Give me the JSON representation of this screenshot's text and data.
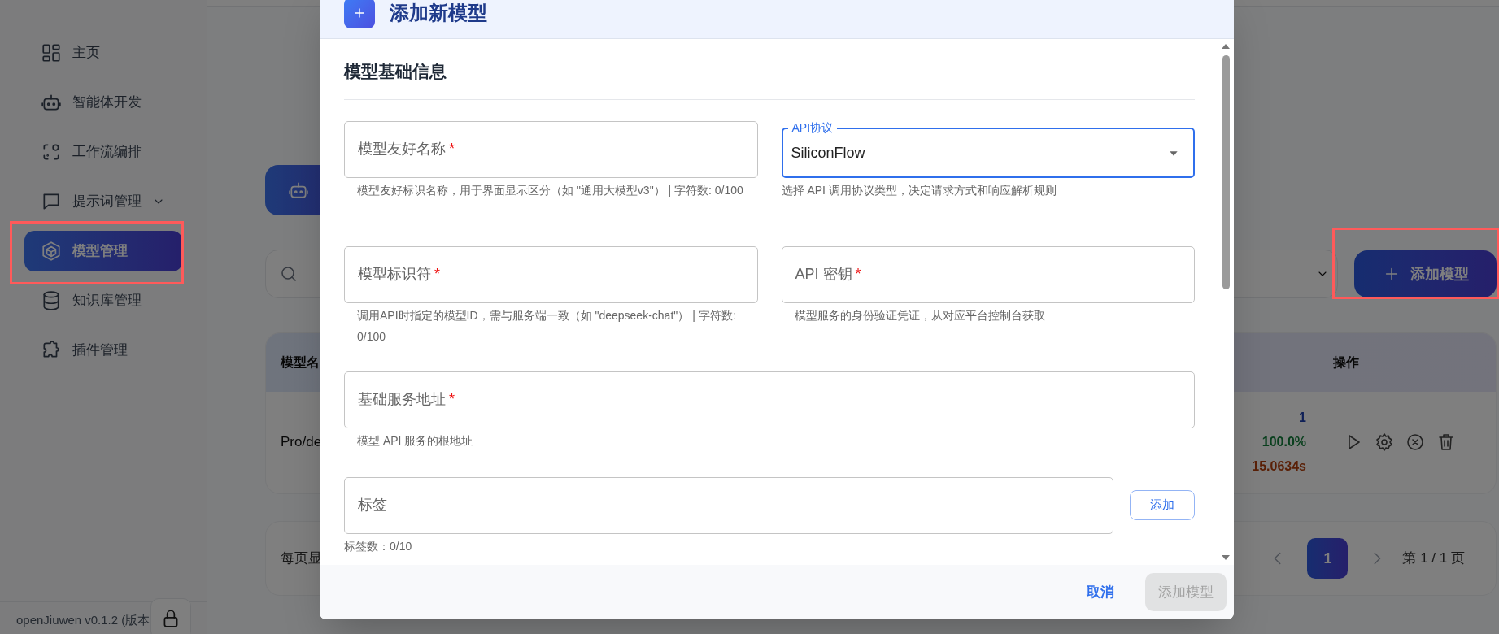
{
  "sidebar": {
    "items": [
      {
        "label": "主页",
        "kind": "link",
        "selected": false,
        "highlighted": false
      },
      {
        "label": "智能体开发",
        "kind": "link",
        "selected": false,
        "highlighted": false
      },
      {
        "label": "工作流编排",
        "kind": "link",
        "selected": false,
        "highlighted": false
      },
      {
        "label": "提示词管理",
        "kind": "group",
        "selected": false,
        "highlighted": false
      },
      {
        "label": "模型管理",
        "kind": "link",
        "selected": true,
        "highlighted": true
      },
      {
        "label": "知识库管理",
        "kind": "link",
        "selected": false,
        "highlighted": false
      },
      {
        "label": "插件管理",
        "kind": "link",
        "selected": false,
        "highlighted": false
      }
    ],
    "version": "openJiuwen v0.1.2 (版本"
  },
  "page": {
    "add_button": {
      "label": "添加模型",
      "highlighted": true
    },
    "table": {
      "columns": [
        "模型名",
        "操作"
      ],
      "rows": [
        {
          "name": "Pro/de",
          "stats": [
            "1",
            "100.0%",
            "15.0634s"
          ]
        }
      ]
    },
    "pagination": {
      "page_size_label": "每页显",
      "pages": [
        {
          "label": "1",
          "selected": true
        }
      ],
      "summary": "第 1 / 1 页"
    }
  },
  "dialog": {
    "title": "添加新模型",
    "section": "模型基础信息",
    "fields": [
      {
        "kind": "text",
        "label": "模型友好名称",
        "required_mark": "*",
        "helper": "模型友好标识名称，用于界面显示区分（如 \"通用大模型v3\"） | 字符数: 0/100"
      },
      {
        "kind": "select",
        "label": "API协议",
        "value": "SiliconFlow",
        "focused": true,
        "helper": "选择 API 调用协议类型，决定请求方式和响应解析规则"
      },
      {
        "kind": "text",
        "label": "模型标识符",
        "required_mark": "*",
        "helper": "调用API时指定的模型ID，需与服务端一致（如 \"deepseek-chat\"） | 字符数: 0/100"
      },
      {
        "kind": "text",
        "label": "API 密钥",
        "required_mark": "*",
        "helper": "模型服务的身份验证凭证，从对应平台控制台获取"
      },
      {
        "kind": "text",
        "label": "基础服务地址",
        "required_mark": "*",
        "helper": "模型 API 服务的根地址"
      },
      {
        "kind": "tags",
        "label": "标签",
        "button": "添加",
        "helper": "标签数：0/10"
      }
    ],
    "buttons": [
      {
        "label": "取消",
        "kind": "text",
        "disabled": false
      },
      {
        "label": "添加模型",
        "kind": "primary",
        "disabled": true
      }
    ]
  }
}
